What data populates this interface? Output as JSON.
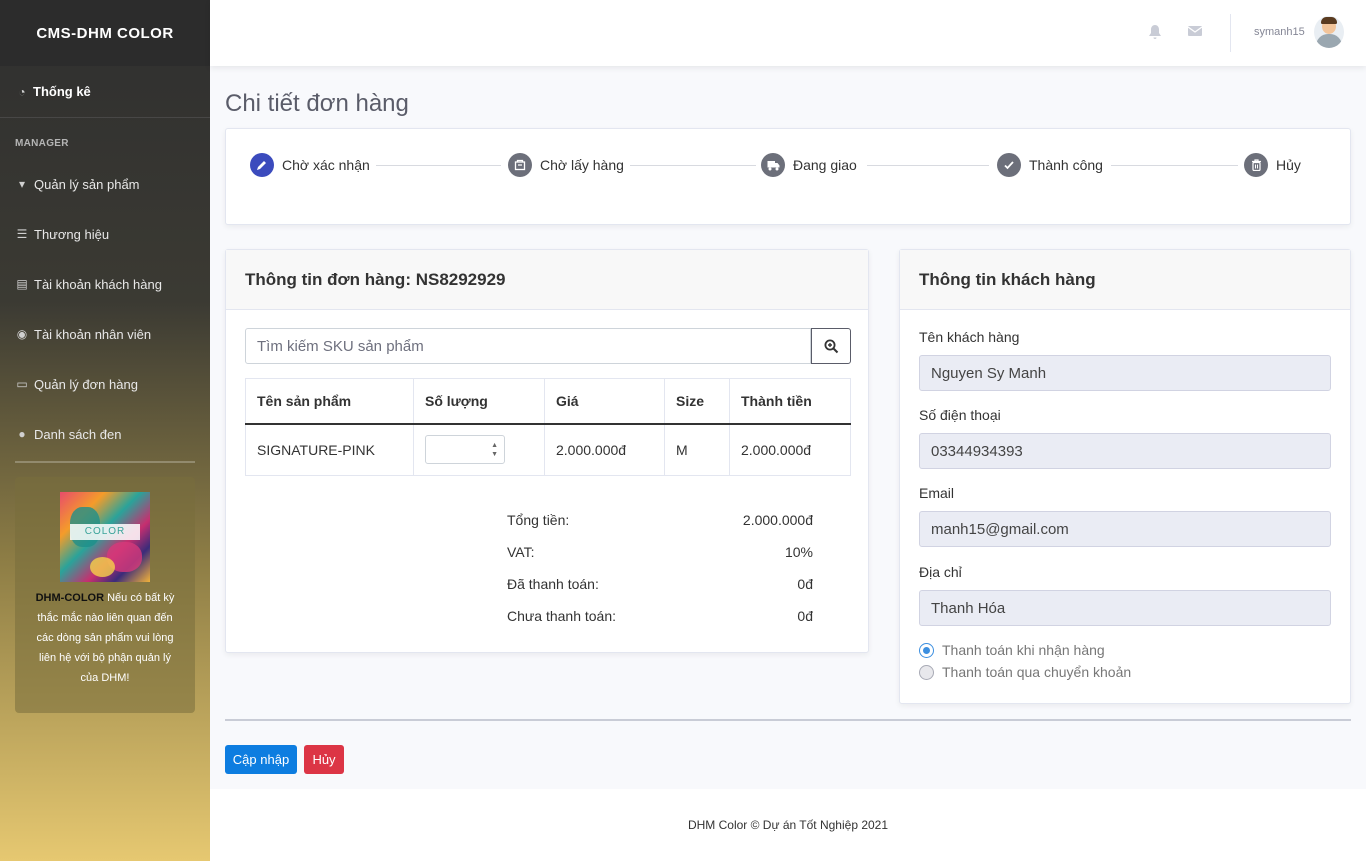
{
  "sidebar": {
    "brand": "CMS-DHM COLOR",
    "dashboard_label": "Thống kê",
    "section_heading": "MANAGER",
    "items": [
      {
        "label": "Quản lý sản phẩm",
        "icon": "tshirt-icon"
      },
      {
        "label": "Thương hiệu",
        "icon": "list-icon"
      },
      {
        "label": "Tài khoản khách hàng",
        "icon": "address-book-icon"
      },
      {
        "label": "Tài khoản nhân viên",
        "icon": "user-circle-icon"
      },
      {
        "label": "Quản lý đơn hàng",
        "icon": "desktop-icon"
      },
      {
        "label": "Danh sách đen",
        "icon": "egg-icon"
      }
    ],
    "promo": {
      "logo_text": "COLOR",
      "brand": "DHM-COLOR",
      "text": " Nếu có bất kỳ thắc mắc nào liên quan đến các dòng sản phẩm vui lòng liên hệ với bộ phận quản lý của DHM!"
    }
  },
  "topbar": {
    "username": "symanh15",
    "icons": [
      "bell-icon",
      "envelope-icon"
    ]
  },
  "page": {
    "title": "Chi tiết đơn hàng"
  },
  "steps": [
    {
      "label": "Chờ xác nhận",
      "icon": "pencil-icon",
      "active": true
    },
    {
      "label": "Chờ lấy hàng",
      "icon": "box-icon",
      "active": false
    },
    {
      "label": "Đang giao",
      "icon": "truck-icon",
      "active": false
    },
    {
      "label": "Thành công",
      "icon": "check-icon",
      "active": false
    },
    {
      "label": "Hủy",
      "icon": "trash-icon",
      "active": false
    }
  ],
  "order": {
    "title": "Thông tin đơn hàng: NS8292929",
    "search_placeholder": "Tìm kiếm SKU sản phẩm",
    "columns": [
      "Tên sản phẩm",
      "Số lượng",
      "Giá",
      "Size",
      "Thành tiền"
    ],
    "rows": [
      {
        "name": "SIGNATURE-PINK",
        "quantity": "",
        "price": "2.000.000đ",
        "size": "M",
        "total": "2.000.000đ"
      }
    ],
    "summary": [
      {
        "label": "Tổng tiền:",
        "value": "2.000.000đ"
      },
      {
        "label": "VAT:",
        "value": "10%"
      },
      {
        "label": "Đã thanh toán:",
        "value": "0đ"
      },
      {
        "label": "Chưa thanh toán:",
        "value": "0đ"
      }
    ]
  },
  "customer": {
    "title": "Thông tin khách hàng",
    "name_label": "Tên khách hàng",
    "name": "Nguyen Sy Manh",
    "phone_label": "Số điện thoại",
    "phone": "03344934393",
    "email_label": "Email",
    "email": "manh15@gmail.com",
    "address_label": "Địa chỉ",
    "address": "Thanh Hóa",
    "payment_options": [
      {
        "label": "Thanh toán khi nhận hàng",
        "checked": true
      },
      {
        "label": "Thanh toán qua chuyển khoản",
        "checked": false
      }
    ]
  },
  "actions": {
    "update": "Cập nhập",
    "cancel": "Hủy"
  },
  "footer": {
    "text": "DHM Color © Dự án Tốt Nghiệp 2021"
  },
  "colors": {
    "primary": "#0d7de0",
    "danger": "#dc3545",
    "step_active": "#3b4bbd"
  }
}
